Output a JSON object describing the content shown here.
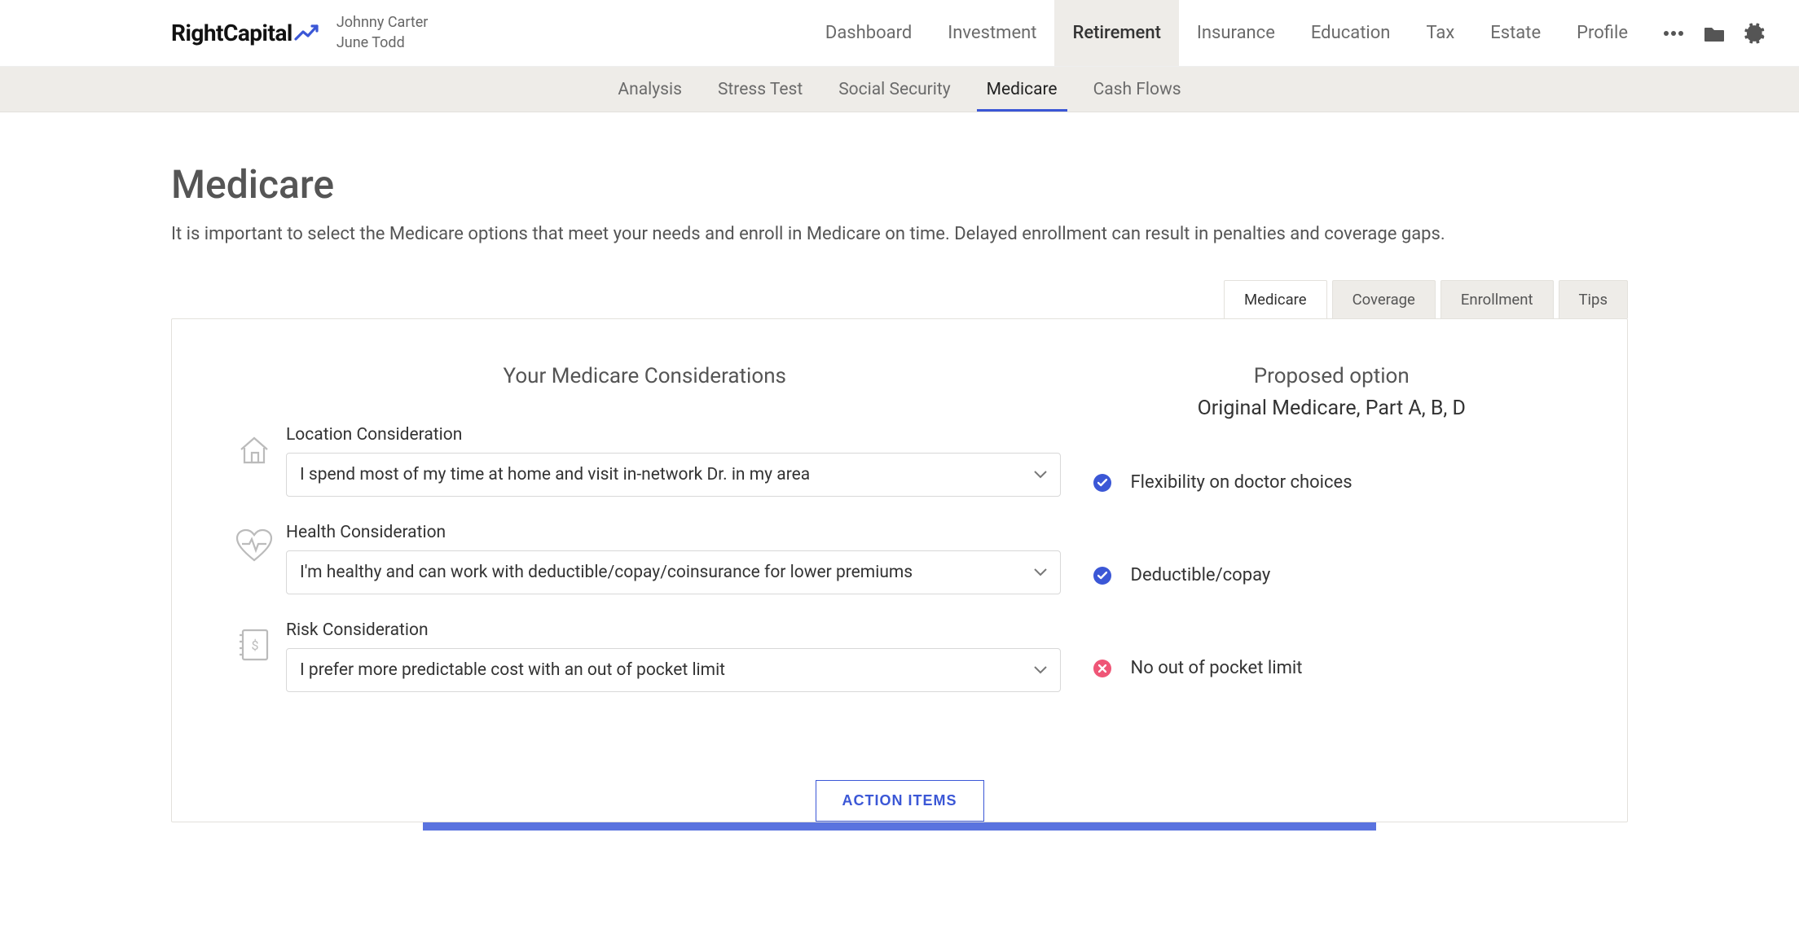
{
  "brand": {
    "name": "RightCapital"
  },
  "user": {
    "line1": "Johnny Carter",
    "line2": "June Todd"
  },
  "mainnav": {
    "items": [
      {
        "label": "Dashboard",
        "active": false
      },
      {
        "label": "Investment",
        "active": false
      },
      {
        "label": "Retirement",
        "active": true
      },
      {
        "label": "Insurance",
        "active": false
      },
      {
        "label": "Education",
        "active": false
      },
      {
        "label": "Tax",
        "active": false
      },
      {
        "label": "Estate",
        "active": false
      },
      {
        "label": "Profile",
        "active": false
      }
    ]
  },
  "subnav": {
    "items": [
      {
        "label": "Analysis",
        "active": false
      },
      {
        "label": "Stress Test",
        "active": false
      },
      {
        "label": "Social Security",
        "active": false
      },
      {
        "label": "Medicare",
        "active": true
      },
      {
        "label": "Cash Flows",
        "active": false
      }
    ]
  },
  "page": {
    "title": "Medicare",
    "description": "It is important to select the Medicare options that meet your needs and enroll in Medicare on time. Delayed enrollment can result in penalties and coverage gaps."
  },
  "card_tabs": [
    {
      "label": "Medicare",
      "active": true
    },
    {
      "label": "Coverage",
      "active": false
    },
    {
      "label": "Enrollment",
      "active": false
    },
    {
      "label": "Tips",
      "active": false
    }
  ],
  "considerations": {
    "heading": "Your Medicare Considerations",
    "rows": [
      {
        "label": "Location Consideration",
        "value": "I spend most of my time at home and visit in-network Dr. in my area"
      },
      {
        "label": "Health Consideration",
        "value": "I'm healthy and can work with deductible/copay/coinsurance for lower premiums"
      },
      {
        "label": "Risk Consideration",
        "value": "I prefer more predictable cost with an out of pocket limit"
      }
    ]
  },
  "proposed": {
    "heading": "Proposed option",
    "option_name": "Original Medicare, Part A, B, D",
    "outcomes": [
      {
        "status": "ok",
        "text": "Flexibility on doctor choices"
      },
      {
        "status": "ok",
        "text": "Deductible/copay"
      },
      {
        "status": "no",
        "text": "No out of pocket limit"
      }
    ]
  },
  "action_button": "ACTION ITEMS"
}
